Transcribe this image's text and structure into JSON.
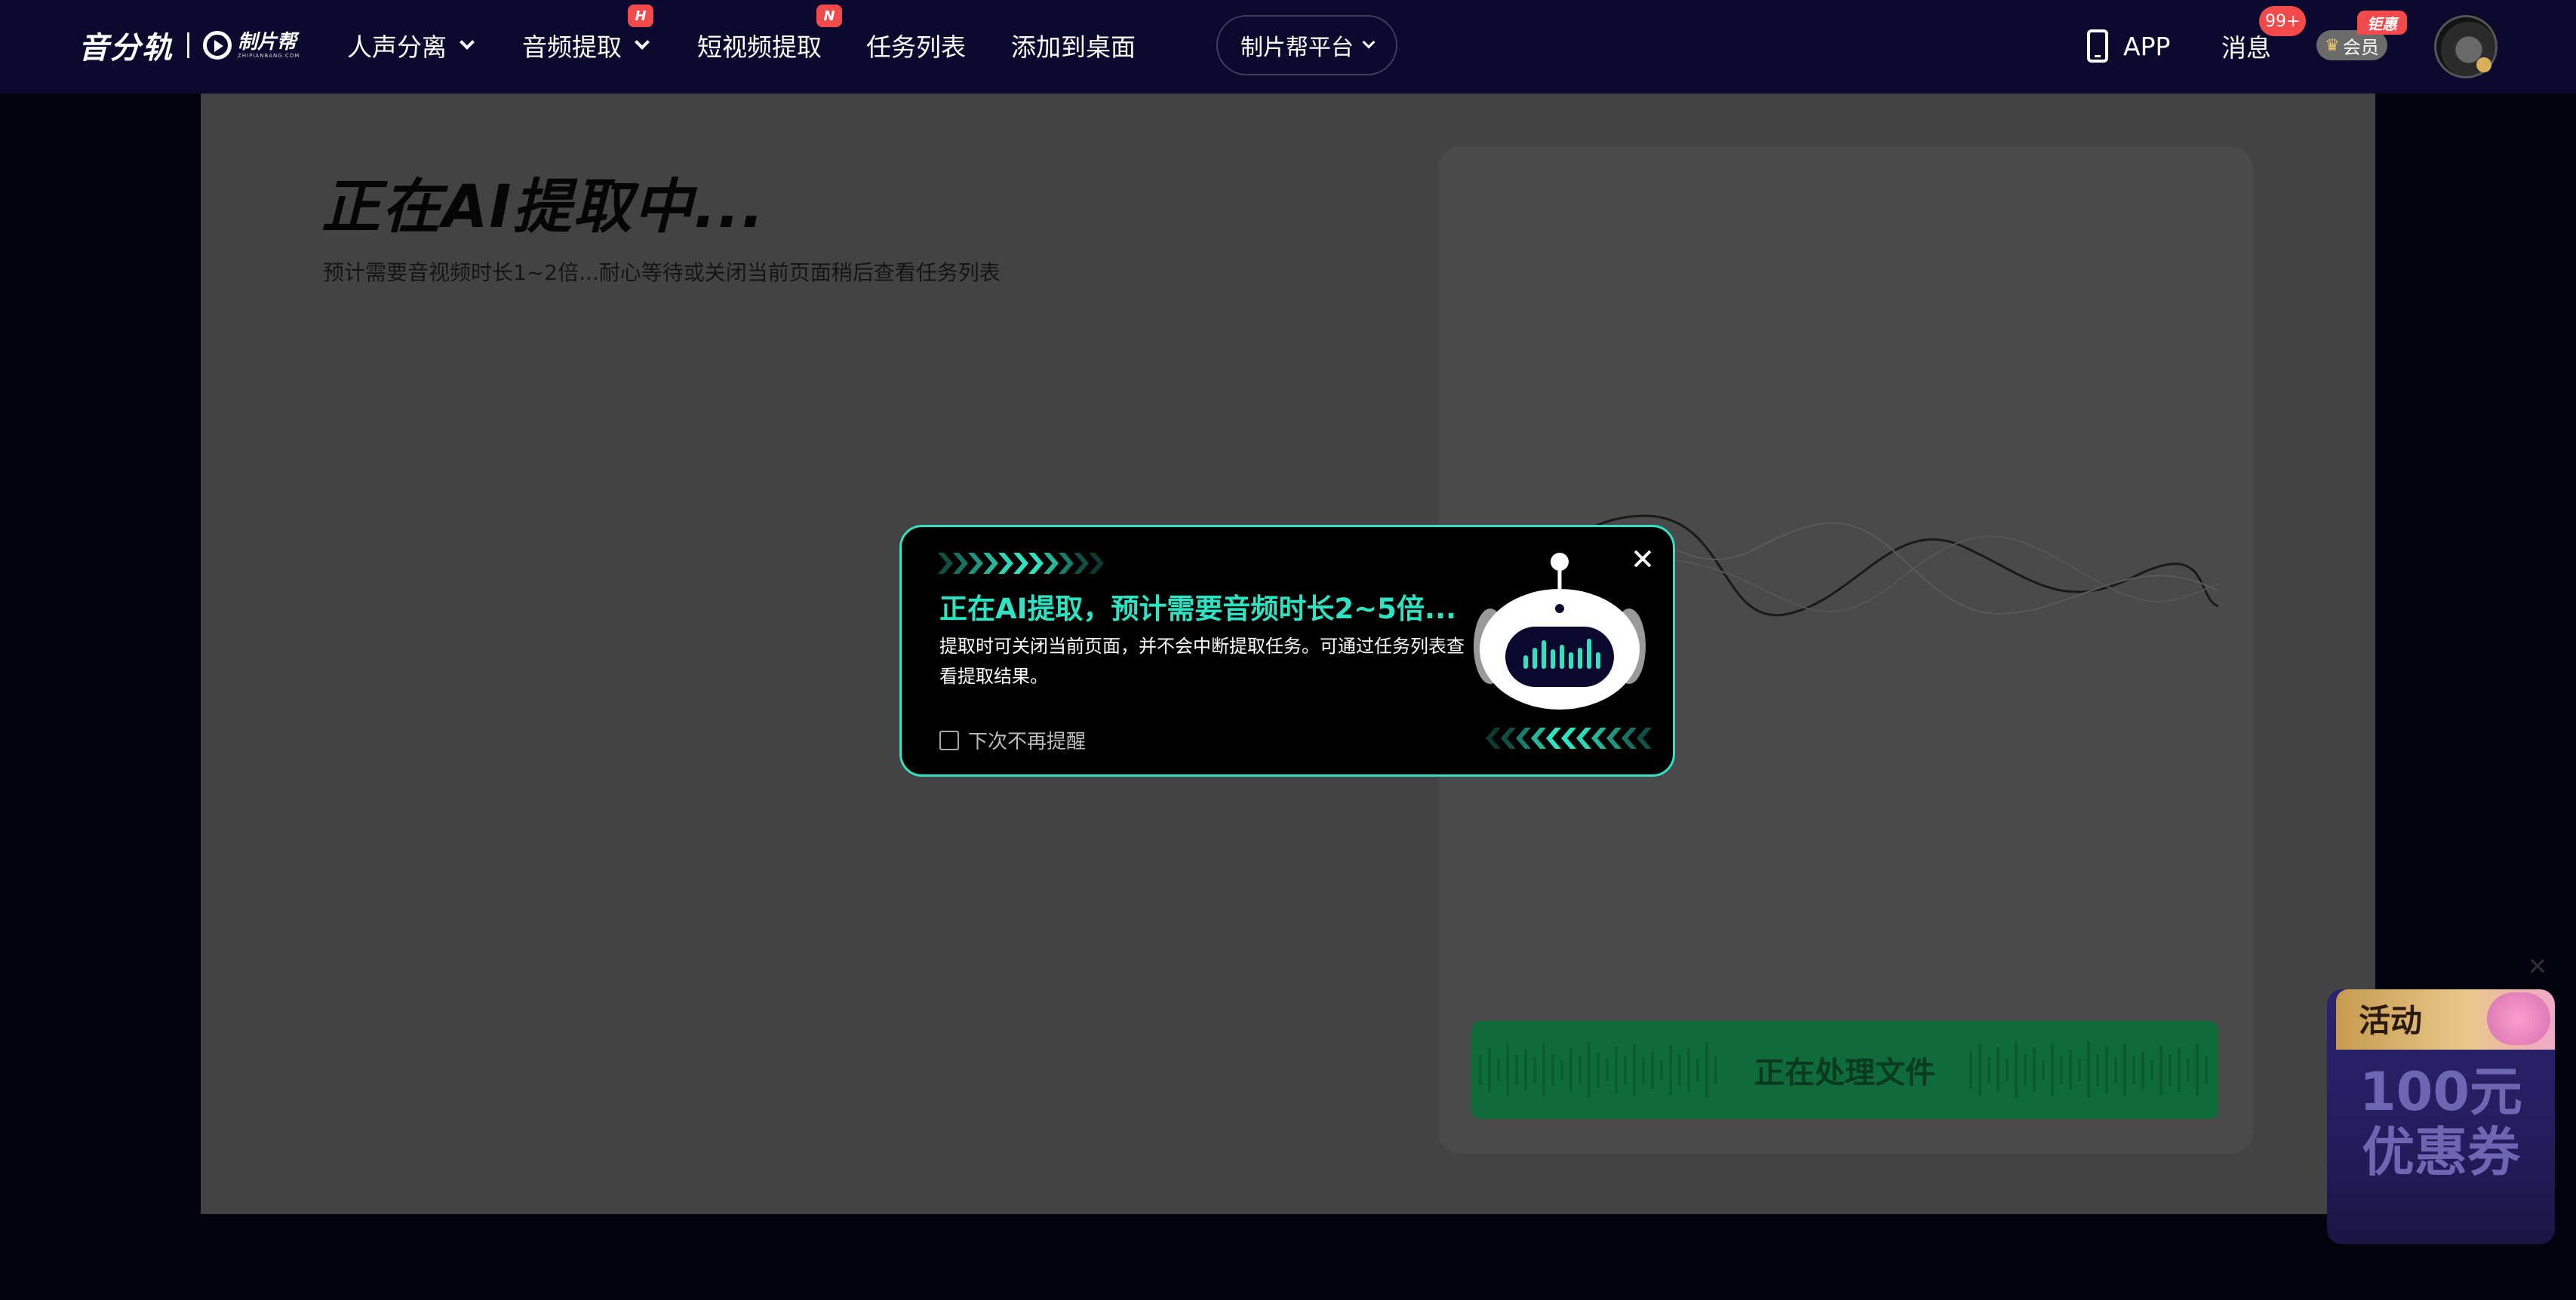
{
  "nav": {
    "brand_main": "音分轨",
    "brand_sub_name": "制片帮",
    "brand_sub_url": "ZHIPIANBANG.COM",
    "items": [
      {
        "label": "人声分离",
        "has_dropdown": true,
        "badge": ""
      },
      {
        "label": "音频提取",
        "has_dropdown": true,
        "badge": "H"
      },
      {
        "label": "短视频提取",
        "has_dropdown": false,
        "badge": "N"
      },
      {
        "label": "任务列表",
        "has_dropdown": false,
        "badge": ""
      },
      {
        "label": "添加到桌面",
        "has_dropdown": false,
        "badge": ""
      }
    ],
    "platform_label": "制片帮平台",
    "app_label": "APP",
    "messages_label": "消息",
    "messages_badge": "99+",
    "vip_label": "会员",
    "vip_badge": "钜惠"
  },
  "main": {
    "title": "正在AI提取中...",
    "subtitle": "预计需要音视频时长1~2倍...耐心等待或关闭当前页面稍后查看任务列表",
    "processing_label": "正在处理文件"
  },
  "modal": {
    "title": "正在AI提取，预计需要音频时长2~5倍...",
    "description": "提取时可关闭当前页面，并不会中断提取任务。可通过任务列表查看提取结果。",
    "checkbox_label": "下次不再提醒",
    "checkbox_checked": false
  },
  "promo": {
    "tag": "活动",
    "amount": "100元",
    "name": "优惠券"
  },
  "colors": {
    "nav_bg": "#0b0a2e",
    "accent": "#2fe3c2",
    "badge_red": "#f24a4a",
    "process_green": "#0f6b3a"
  }
}
